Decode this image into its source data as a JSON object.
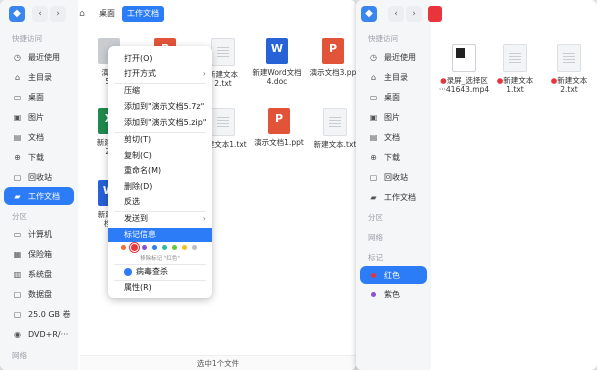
{
  "window1": {
    "breadcrumb": [
      "桌面",
      "工作文档"
    ],
    "sidebar": {
      "quick_access_label": "快捷访问",
      "items": [
        {
          "label": "最近使用",
          "icon": "clock-icon"
        },
        {
          "label": "主目录",
          "icon": "home-icon"
        },
        {
          "label": "桌面",
          "icon": "desktop-icon"
        },
        {
          "label": "图片",
          "icon": "image-icon"
        },
        {
          "label": "文档",
          "icon": "document-icon"
        },
        {
          "label": "下载",
          "icon": "download-icon"
        },
        {
          "label": "回收站",
          "icon": "trash-icon"
        },
        {
          "label": "工作文档",
          "icon": "folder-icon",
          "active": true
        }
      ],
      "partition_label": "分区",
      "drives": [
        {
          "label": "计算机",
          "icon": "computer-icon"
        },
        {
          "label": "保险箱",
          "icon": "safe-icon"
        },
        {
          "label": "系统盘",
          "icon": "disk-icon"
        },
        {
          "label": "数据盘",
          "icon": "disk-icon"
        },
        {
          "label": "25.0 GB 卷",
          "icon": "disk-icon"
        },
        {
          "label": "DVD+R/···",
          "icon": "dvd-icon"
        }
      ],
      "network_label": "网络"
    },
    "files": [
      {
        "name": "演示",
        "name2": "5.",
        "type": "sel"
      },
      {
        "name": "",
        "name2": "",
        "type": "ppt"
      },
      {
        "name": "新建文本",
        "name2": "2.txt",
        "type": "txt"
      },
      {
        "name": "新建Word文档",
        "name2": "4.doc",
        "type": "word"
      },
      {
        "name": "演示文档3.pp",
        "name2": "",
        "type": "ppt"
      },
      {
        "name": "新建Ex",
        "name2": "2.",
        "type": "xls"
      },
      {
        "name": "",
        "name2": "",
        "type": "txt"
      },
      {
        "name": "新建文本1.txt",
        "name2": "",
        "type": "txt"
      },
      {
        "name": "演示文档1.ppt",
        "name2": "",
        "type": "ppt"
      },
      {
        "name": "新建文本.txt",
        "name2": "",
        "type": "txt"
      },
      {
        "name": "新建W",
        "name2": "档.",
        "type": "word"
      }
    ],
    "status": "选中1个文件"
  },
  "context_menu": {
    "items": [
      "打开(O)",
      "打开方式",
      "压缩",
      "添加到\"演示文档5.7z\"",
      "添加到\"演示文档5.zip\"",
      "剪切(T)",
      "复制(C)",
      "重命名(M)",
      "删除(D)",
      "反选",
      "发送到",
      "标记信息"
    ],
    "tag_hint": "移除标记 \"红色\"",
    "virus_scan": "病毒查杀",
    "properties": "属性(R)",
    "colors": [
      "#f06a35",
      "#e8343a",
      "#8b4fd6",
      "#2b7cf6",
      "#2fb7a0",
      "#69c43a",
      "#f2c21a",
      "#b9bec6"
    ]
  },
  "window2": {
    "sidebar": {
      "quick_access_label": "快捷访问",
      "items": [
        {
          "label": "最近使用",
          "icon": "clock-icon"
        },
        {
          "label": "主目录",
          "icon": "home-icon"
        },
        {
          "label": "桌面",
          "icon": "desktop-icon"
        },
        {
          "label": "图片",
          "icon": "image-icon"
        },
        {
          "label": "文档",
          "icon": "document-icon"
        },
        {
          "label": "下载",
          "icon": "download-icon"
        },
        {
          "label": "回收站",
          "icon": "trash-icon"
        },
        {
          "label": "工作文档",
          "icon": "folder-icon"
        }
      ],
      "partition_label": "分区",
      "network_label": "网络",
      "tags_label": "标记",
      "tags": [
        {
          "label": "红色",
          "color": "#e8343a",
          "active": true
        },
        {
          "label": "紫色",
          "color": "#8b4fd6"
        }
      ]
    },
    "files": [
      {
        "name": "录屏_选择区",
        "name2": "···41643.mp4",
        "type": "mp4",
        "tag": "#e8343a"
      },
      {
        "name": "新建文本",
        "name2": "1.txt",
        "type": "txt",
        "tag": "#e8343a"
      },
      {
        "name": "新建文本",
        "name2": "2.txt",
        "type": "txt",
        "tag": "#e8343a"
      }
    ]
  }
}
